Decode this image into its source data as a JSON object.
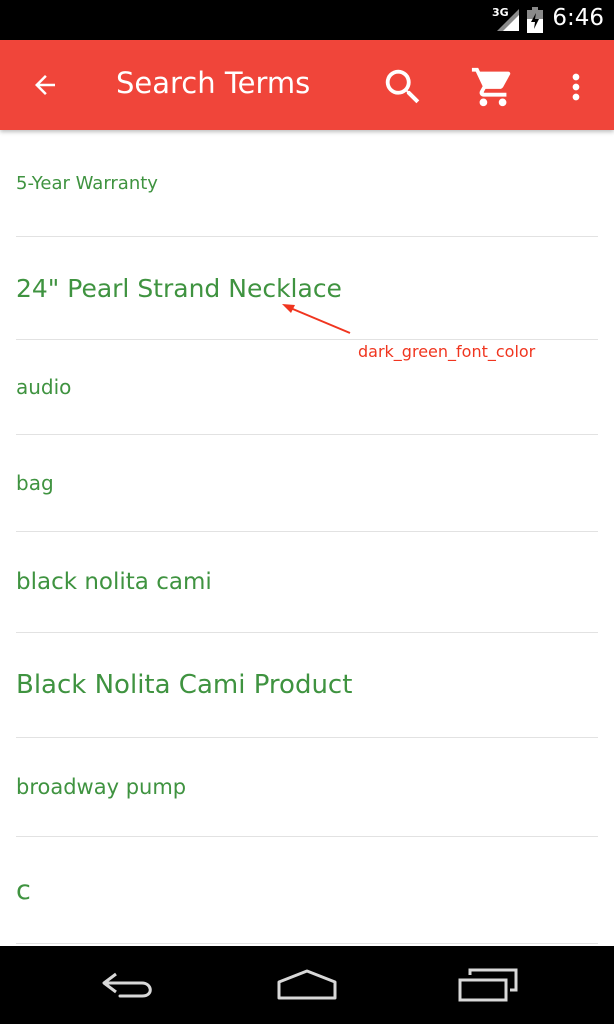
{
  "status_bar": {
    "network": "3G",
    "time": "6:46"
  },
  "app_bar": {
    "title": "Search Terms",
    "color": "#f0453a",
    "icons": [
      "arrow-back-icon",
      "search-icon",
      "cart-icon",
      "more-vert-icon"
    ]
  },
  "list": {
    "text_color": "#3f9340",
    "items": [
      {
        "label": "5-Year Warranty"
      },
      {
        "label": "24\" Pearl Strand Necklace"
      },
      {
        "label": "audio"
      },
      {
        "label": "bag"
      },
      {
        "label": "black nolita cami"
      },
      {
        "label": "Black Nolita Cami Product"
      },
      {
        "label": "broadway pump"
      },
      {
        "label": "c"
      }
    ]
  },
  "annotation": {
    "label": "dark_green_font_color",
    "color": "#f0351f"
  },
  "nav_bar": {
    "icons": [
      "nav-back-icon",
      "nav-home-icon",
      "nav-recents-icon"
    ]
  }
}
